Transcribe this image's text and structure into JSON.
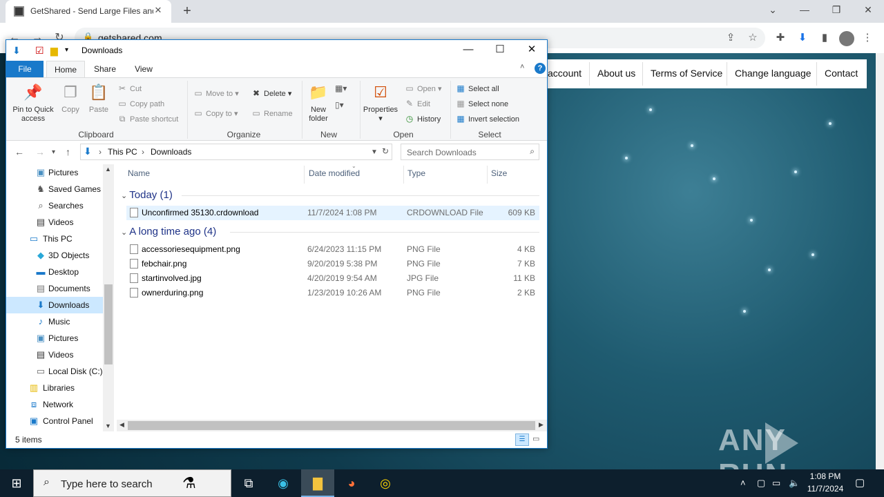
{
  "browser": {
    "tab_title": "GetShared - Send Large Files and",
    "tab_close": "✕",
    "new_tab": "+",
    "address": "getshared.com",
    "window_controls": {
      "chevron": "⌄",
      "minimize": "—",
      "restore": "❐",
      "close": "✕"
    }
  },
  "website": {
    "nav": [
      "account",
      "About us",
      "Terms of Service",
      "Change language",
      "Contact"
    ],
    "watermark_left": "ANY",
    "watermark_right": "RUN"
  },
  "explorer": {
    "title": "Downloads",
    "controls": {
      "minimize": "—",
      "maximize": "☐",
      "close": "✕"
    },
    "ribbon_tabs": {
      "file": "File",
      "home": "Home",
      "share": "Share",
      "view": "View"
    },
    "help": "?",
    "clipboard": {
      "pin": "Pin to Quick access",
      "copy": "Copy",
      "paste": "Paste",
      "cut": "Cut",
      "copy_path": "Copy path",
      "paste_shortcut": "Paste shortcut",
      "label": "Clipboard"
    },
    "organize": {
      "move_to": "Move to",
      "copy_to": "Copy to",
      "delete": "Delete",
      "rename": "Rename",
      "label": "Organize"
    },
    "new": {
      "new_folder": "New folder",
      "label": "New"
    },
    "open": {
      "properties": "Properties",
      "open": "Open",
      "edit": "Edit",
      "history": "History",
      "label": "Open"
    },
    "select": {
      "select_all": "Select all",
      "select_none": "Select none",
      "invert": "Invert selection",
      "label": "Select"
    },
    "address": {
      "crumb1": "This PC",
      "crumb2": "Downloads"
    },
    "search_placeholder": "Search Downloads",
    "nav_pane": [
      {
        "label": "Pictures",
        "icon": "pictures-icon"
      },
      {
        "label": "Saved Games",
        "icon": "saved-games-icon"
      },
      {
        "label": "Searches",
        "icon": "searches-icon"
      },
      {
        "label": "Videos",
        "icon": "videos-icon"
      },
      {
        "label": "This PC",
        "icon": "this-pc-icon"
      },
      {
        "label": "3D Objects",
        "icon": "3d-objects-icon"
      },
      {
        "label": "Desktop",
        "icon": "desktop-icon"
      },
      {
        "label": "Documents",
        "icon": "documents-icon"
      },
      {
        "label": "Downloads",
        "icon": "downloads-icon"
      },
      {
        "label": "Music",
        "icon": "music-icon"
      },
      {
        "label": "Pictures",
        "icon": "pictures-icon"
      },
      {
        "label": "Videos",
        "icon": "videos-icon"
      },
      {
        "label": "Local Disk (C:)",
        "icon": "disk-icon"
      },
      {
        "label": "Libraries",
        "icon": "libraries-icon"
      },
      {
        "label": "Network",
        "icon": "network-icon"
      },
      {
        "label": "Control Panel",
        "icon": "control-panel-icon"
      }
    ],
    "columns": {
      "name": "Name",
      "date": "Date modified",
      "type": "Type",
      "size": "Size"
    },
    "groups": [
      {
        "label": "Today (1)",
        "files": [
          {
            "name": "Unconfirmed 35130.crdownload",
            "date": "11/7/2024 1:08 PM",
            "type": "CRDOWNLOAD File",
            "size": "609 KB"
          }
        ]
      },
      {
        "label": "A long time ago (4)",
        "files": [
          {
            "name": "accessoriesequipment.png",
            "date": "6/24/2023 11:15 PM",
            "type": "PNG File",
            "size": "4 KB"
          },
          {
            "name": "febchair.png",
            "date": "9/20/2019 5:38 PM",
            "type": "PNG File",
            "size": "7 KB"
          },
          {
            "name": "startinvolved.jpg",
            "date": "4/20/2019 9:54 AM",
            "type": "JPG File",
            "size": "11 KB"
          },
          {
            "name": "ownerduring.png",
            "date": "1/23/2019 10:26 AM",
            "type": "PNG File",
            "size": "2 KB"
          }
        ]
      }
    ],
    "status": "5 items"
  },
  "taskbar": {
    "search_placeholder": "Type here to search",
    "time": "1:08 PM",
    "date": "11/7/2024"
  },
  "colors": {
    "accent": "#1979ca",
    "selection": "#cce8ff",
    "taskbar": "#0d1f2d"
  }
}
